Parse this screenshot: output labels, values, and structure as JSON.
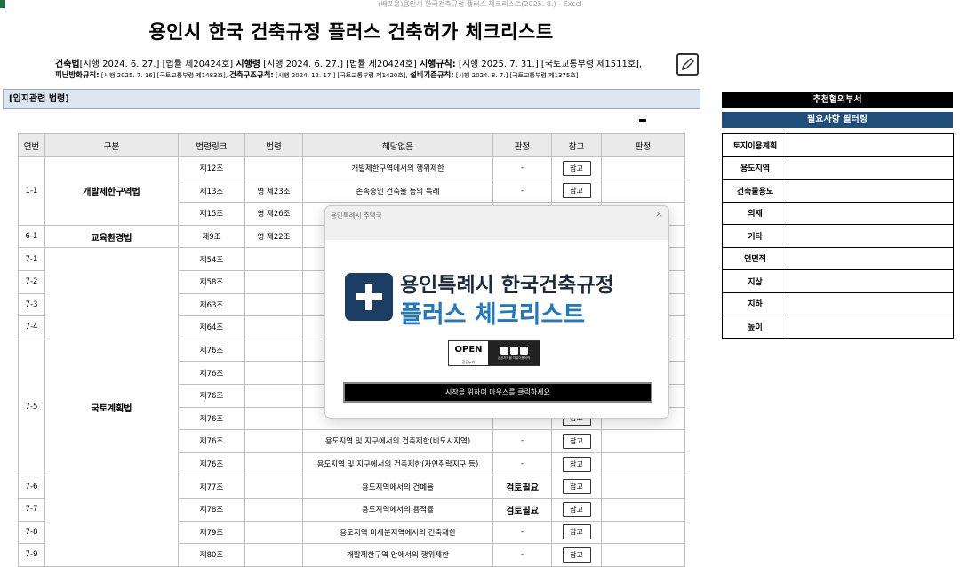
{
  "window": {
    "title": "(배포용)용인시 한국건축규정 플러스 체크리스트(2025. 8.) - Excel"
  },
  "header": {
    "title": "용인시 한국 건축규정 플러스 건축허가 체크리스트",
    "law_line1": {
      "b1": "건축법",
      "t1": "[시행 2024. 6. 27.] [법률 제20424호] ",
      "b2": "시행령",
      "t2": " [시행 2024. 6. 27.] [법률 제20424호] ",
      "b3": "시행규칙:",
      "t3": " [시행 2025. 7. 31.] [국토교통부령 제1511호],"
    },
    "law_line2": {
      "b1": "피난방화규칙:",
      "t1": " [시행 2025. 7. 16] [국토교통부령 제1483호], ",
      "b2": "건축구조규칙:",
      "t2": " [시행 2024. 12. 17.] [국토교통부령 제1420호], ",
      "b3": "설비기준규칙:",
      "t3": " [시행 2024. 8. 7.] [국토교통부령 제1375호]"
    }
  },
  "panel": {
    "title": "[입지관련 법령]",
    "dash": "-"
  },
  "table": {
    "headers": [
      "연번",
      "구분",
      "법령링크",
      "법령",
      "해당없음",
      "판정",
      "참고",
      "판정"
    ],
    "ref_label": "참고",
    "rows": [
      {
        "no": "1-1",
        "cat": "개발제한구역법",
        "link": "제12조",
        "law": "",
        "desc": "개발제한구역에서의 행위제한",
        "judge": "-"
      },
      {
        "link": "제13조",
        "law": "영 제23조",
        "desc": "존속중인 건축물 등의 특례",
        "judge": "-"
      },
      {
        "link": "제15조",
        "law": "영 제26조",
        "desc": "",
        "judge": ""
      },
      {
        "no": "6-1",
        "cat": "교육환경법",
        "link": "제9조",
        "law": "영 제22조",
        "desc": "",
        "judge": ""
      },
      {
        "no": "7-1",
        "cat": "국토계획법",
        "link": "제54조",
        "law": "",
        "desc": "",
        "judge": ""
      },
      {
        "no": "7-2",
        "link": "제58조",
        "law": "",
        "desc": "",
        "judge": ""
      },
      {
        "no": "7-3",
        "link": "제63조",
        "law": "",
        "desc": "",
        "judge": ""
      },
      {
        "no": "7-4",
        "link": "제64조",
        "law": "",
        "desc": "",
        "judge": ""
      },
      {
        "no": "7-5",
        "link": "제76조",
        "law": "",
        "desc": "",
        "judge": ""
      },
      {
        "link": "제76조",
        "law": "",
        "desc": "",
        "judge": ""
      },
      {
        "link": "제76조",
        "law": "",
        "desc": "",
        "judge": ""
      },
      {
        "link": "제76조",
        "law": "",
        "desc": "",
        "judge": ""
      },
      {
        "link": "제76조",
        "law": "",
        "desc": "용도지역 및 지구에서의 건축제한(비도시지역)",
        "judge": "-"
      },
      {
        "link": "제76조",
        "law": "",
        "desc": "용도지역 및 지구에서의 건축제한(자연취락지구 등)",
        "judge": "-"
      },
      {
        "no": "7-6",
        "link": "제77조",
        "law": "",
        "desc": "용도지역에서의 건폐율",
        "judge": "검토필요"
      },
      {
        "no": "7-7",
        "link": "제78조",
        "law": "",
        "desc": "용도지역에서의 용적률",
        "judge": "검토필요"
      },
      {
        "no": "7-8",
        "link": "제79조",
        "law": "",
        "desc": "용도지역 미세분지역에서의 건축제한",
        "judge": "-"
      },
      {
        "no": "7-9",
        "link": "제80조",
        "law": "",
        "desc": "개발제한구역 안에서의 행위제한",
        "judge": "-"
      }
    ]
  },
  "right": {
    "title1": "추천협의부서",
    "title2": "필요사항 필터링",
    "filters": [
      "토지이용계획",
      "용도지역",
      "건축물용도",
      "의제",
      "기타",
      "연면적",
      "지상",
      "지하",
      "높이"
    ]
  },
  "popup": {
    "title": "용인특례시 주택국",
    "close": "×",
    "logo_line1": "용인특례시 한국건축규정",
    "logo_line2": "플러스 체크리스트",
    "open_text": "OPEN",
    "open_sub": "공공누리",
    "open_caption": "공공저작물 자유이용허락",
    "start_button": "시작을 위하여 마우스를 클릭하세요"
  }
}
